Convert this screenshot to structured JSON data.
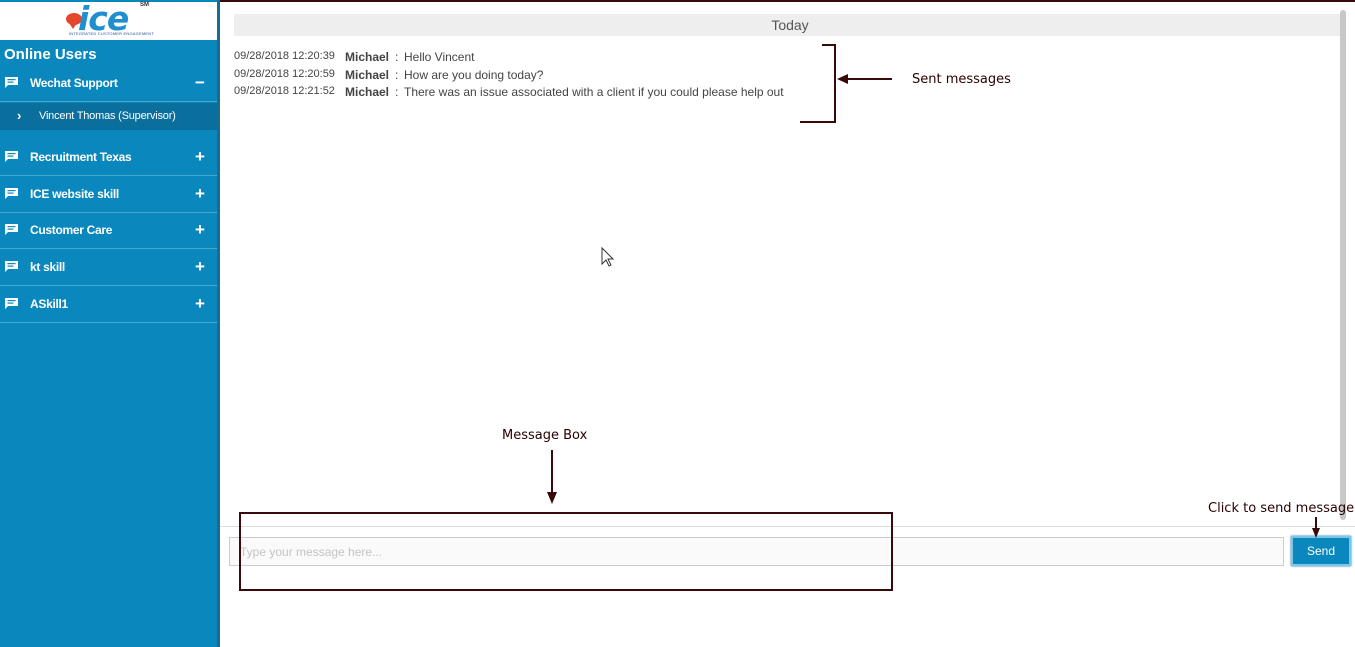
{
  "logo": {
    "text": "ice",
    "sm": "SM",
    "tagline": "INTEGRATED CUSTOMER ENGAGEMENT"
  },
  "sidebar": {
    "title": "Online Users",
    "groups": [
      {
        "label": "Wechat Support",
        "toggle": "−"
      },
      {
        "label": "Recruitment Texas",
        "toggle": "+"
      },
      {
        "label": "ICE website skill",
        "toggle": "+"
      },
      {
        "label": "Customer Care",
        "toggle": "+"
      },
      {
        "label": "kt skill",
        "toggle": "+"
      },
      {
        "label": "ASkill1",
        "toggle": "+"
      }
    ],
    "active_subitem": {
      "label": "Vincent Thomas (Supervisor)"
    }
  },
  "chat": {
    "date_header": "Today",
    "messages": [
      {
        "timestamp": "09/28/2018 12:20:39",
        "sender": "Michael",
        "separator": ":",
        "text": "Hello Vincent"
      },
      {
        "timestamp": "09/28/2018 12:20:59",
        "sender": "Michael",
        "separator": ":",
        "text": "How are you doing today?"
      },
      {
        "timestamp": "09/28/2018 12:21:52",
        "sender": "Michael",
        "separator": ":",
        "text": "There was an issue associated with a client if you could please help out"
      }
    ]
  },
  "composer": {
    "placeholder": "Type your message here...",
    "value": "",
    "send_label": "Send"
  },
  "annotations": {
    "sent_messages": "Sent messages",
    "message_box": "Message Box",
    "click_to_send": "Click to send message"
  },
  "colors": {
    "sidebar": "#0a88bd",
    "sidebar_active": "#0b6f9e",
    "annotation": "#3a0a0a"
  }
}
